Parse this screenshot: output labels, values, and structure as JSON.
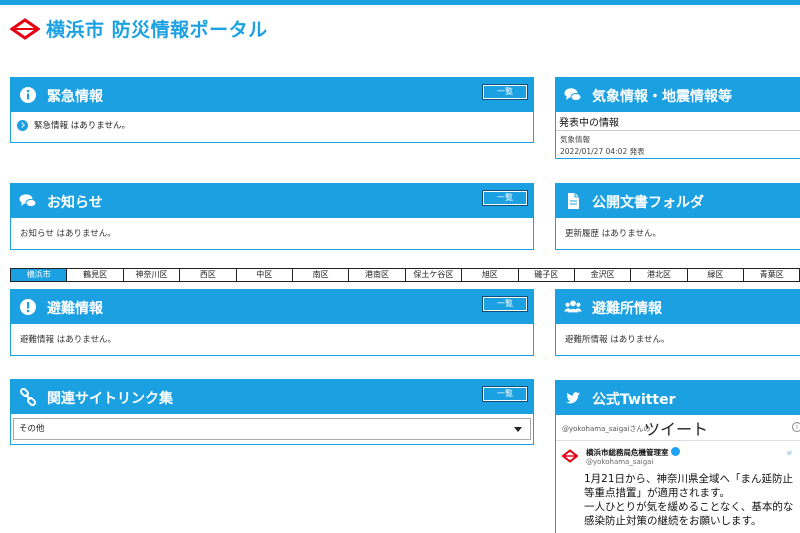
{
  "header": {
    "title": "横浜市 防災情報ポータル"
  },
  "emergency": {
    "title": "緊急情報",
    "more_label": "一覧",
    "item": "緊急情報 はありません。"
  },
  "weather": {
    "title": "気象情報・地震情報等",
    "subheading": "発表中の情報",
    "item_title": "気象情報",
    "item_date": "2022/01/27 04:02 発表"
  },
  "notices": {
    "title": "お知らせ",
    "more_label": "一覧",
    "text": "お知らせ はありません。"
  },
  "documents": {
    "title": "公開文書フォルダ",
    "text": "更新履歴 はありません。"
  },
  "wards": {
    "items": [
      "横浜市",
      "鶴見区",
      "神奈川区",
      "西区",
      "中区",
      "南区",
      "港南区",
      "保土ケ谷区",
      "旭区",
      "磯子区",
      "金沢区",
      "港北区",
      "緑区",
      "青葉区"
    ],
    "active": "横浜市"
  },
  "evacuation": {
    "title": "避難情報",
    "more_label": "一覧",
    "text": "避難情報 はありません。"
  },
  "shelters": {
    "title": "避難所情報",
    "text": "避難所情報 はありません。"
  },
  "links": {
    "title": "関連サイトリンク集",
    "more_label": "一覧",
    "selected": "その他"
  },
  "twitter": {
    "title": "公式Twitter",
    "by_label": "@yokohama_saigaiさんの",
    "tweet_word": "ツイート",
    "account_name": "横浜市総務局危機管理室",
    "handle": "@yokohama_saigai",
    "text": " 1月21日から、神奈川県全域へ「まん延防止等重点措置」が適用されます。\n一人ひとりが気を緩めることなく、基本的な感染防止対策の継続をお願いします。"
  },
  "colors": {
    "accent": "#1ba1e2",
    "logo_red": "#e60012"
  }
}
